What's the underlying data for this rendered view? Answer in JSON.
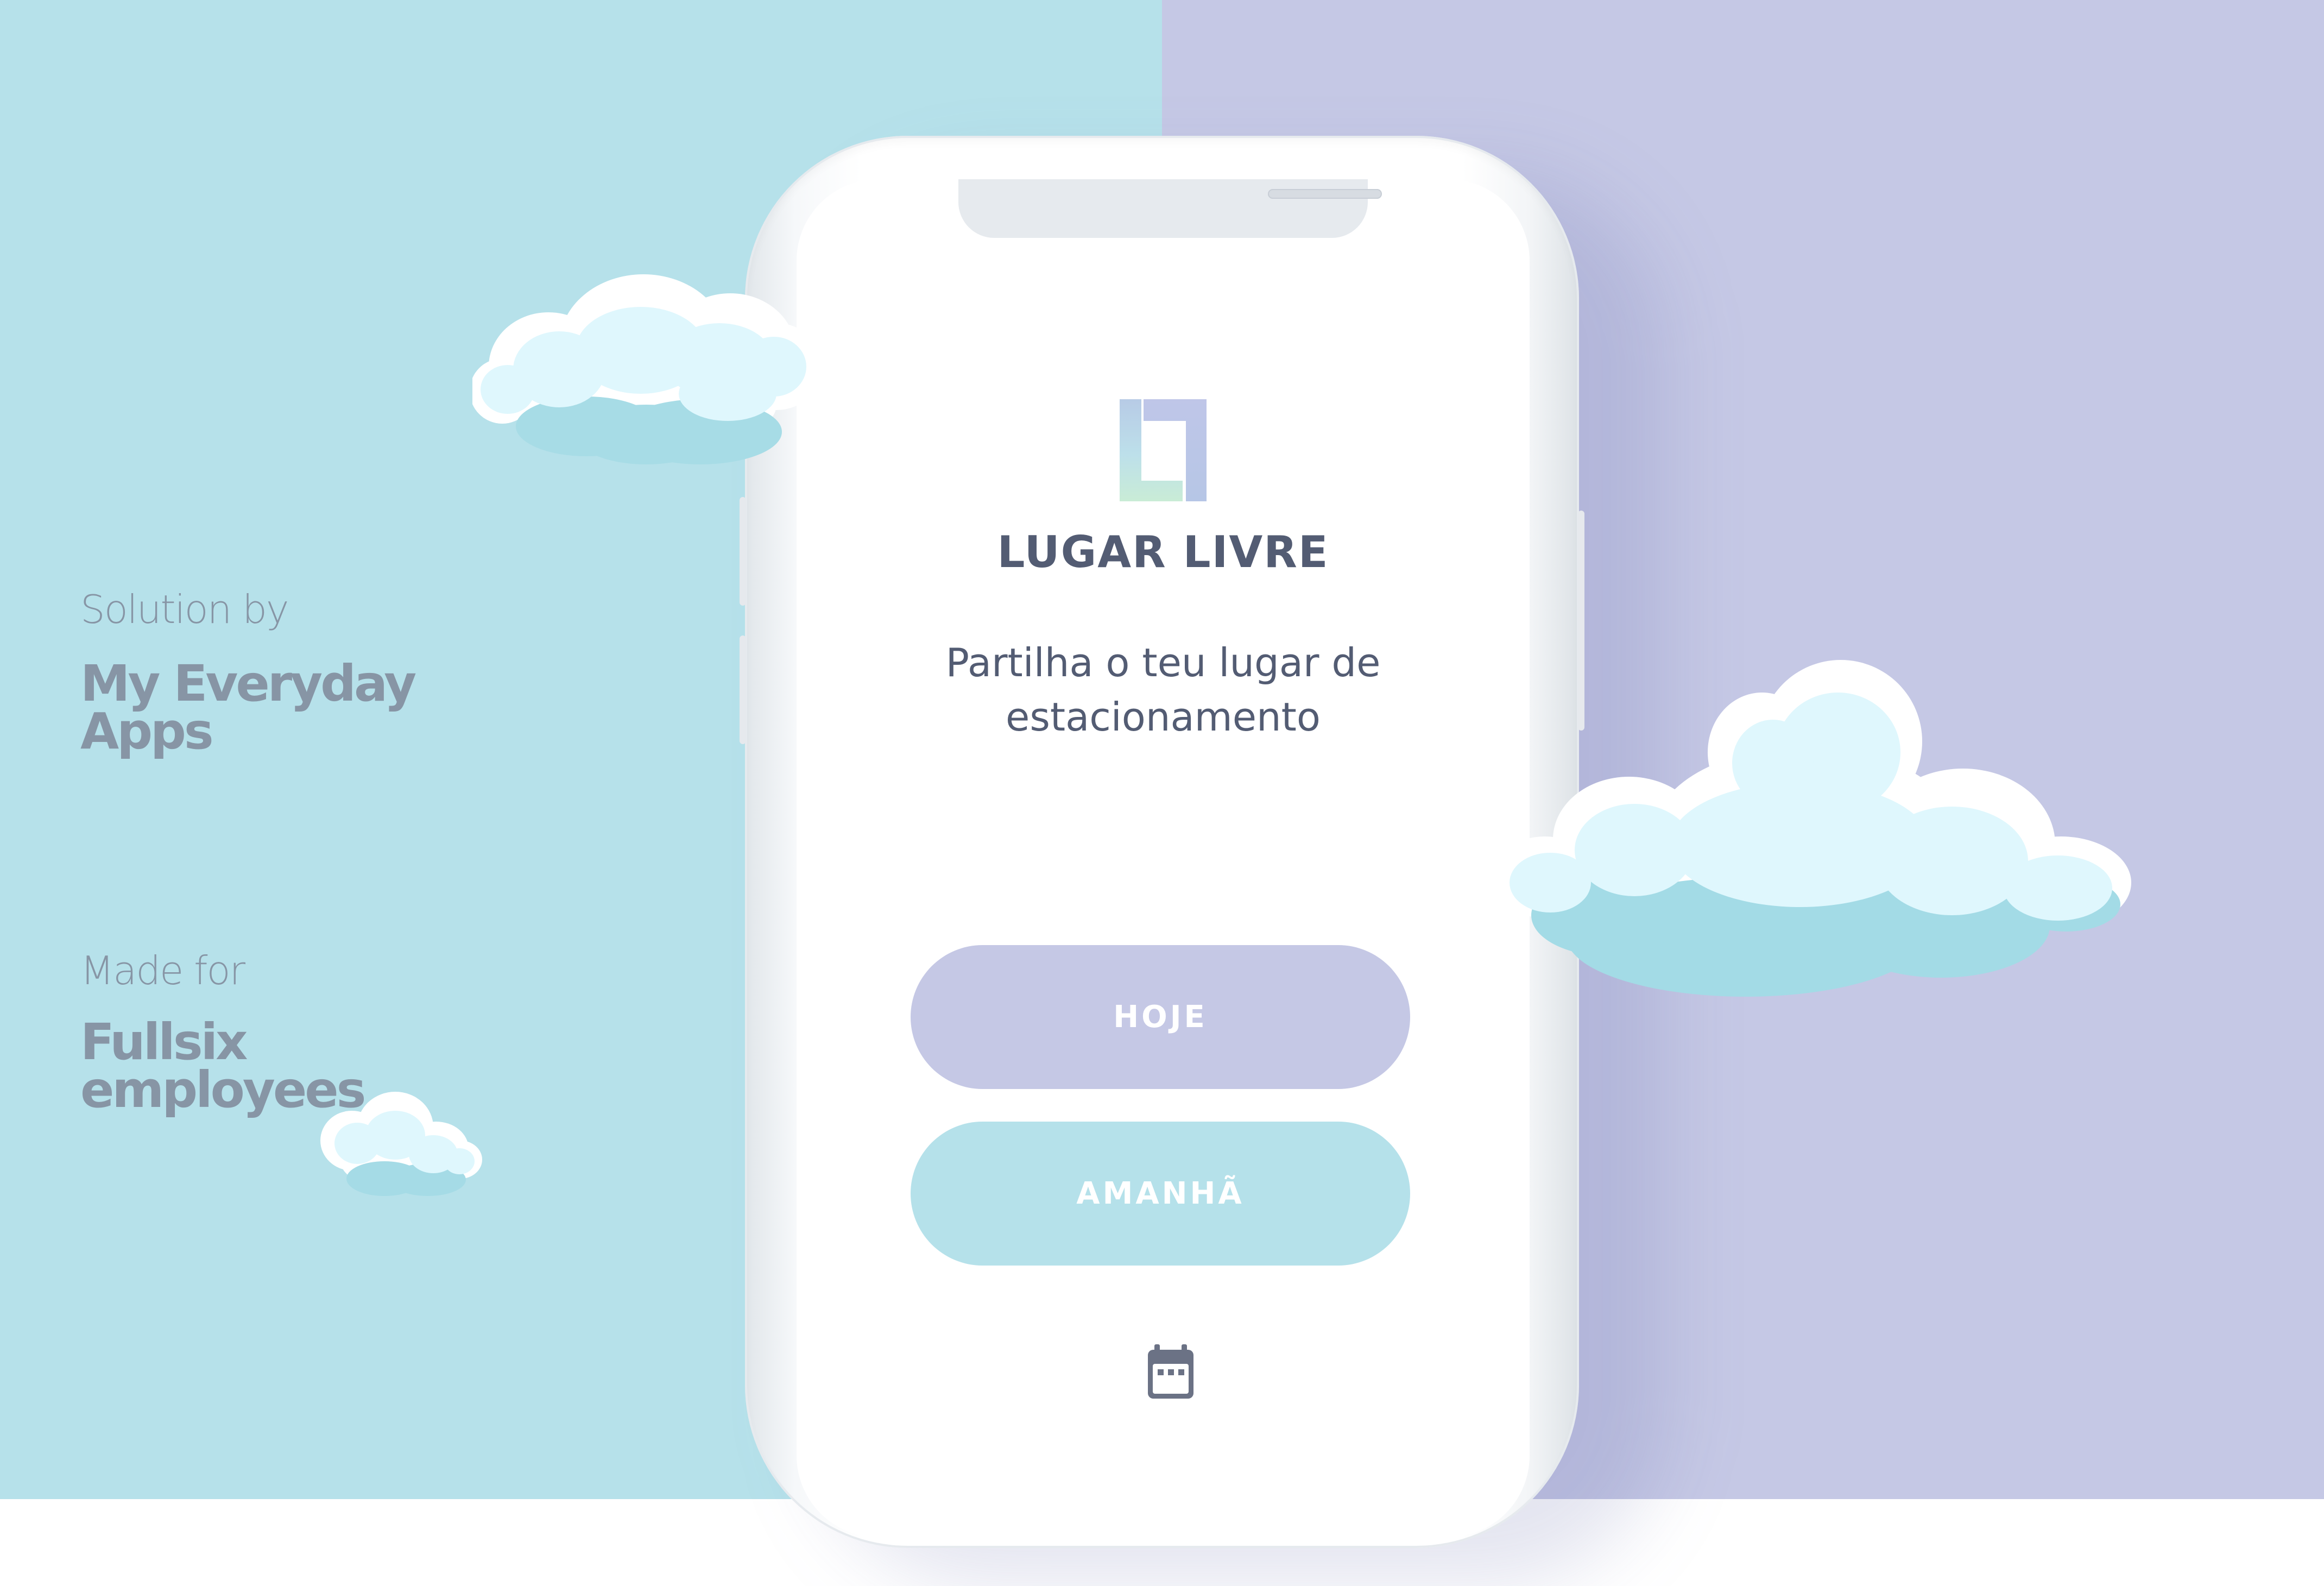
{
  "colors": {
    "background_left": "#b6e1ea",
    "background_right": "#c5c8e5",
    "text_dark": "#535c73",
    "text_side": "#8795a5",
    "button_today": "#c5c8e5",
    "button_tomorrow": "#b5e1ea"
  },
  "side": {
    "solution_caption": "Solution by",
    "solution_name": "My Everyday Apps",
    "made_caption": "Made for",
    "made_name": "Fullsix employees"
  },
  "app": {
    "logo_icon": "lugar-livre-logo",
    "title": "LUGAR LIVRE",
    "subtitle": "Partilha o teu lugar de estacionamento",
    "buttons": {
      "today": "HOJE",
      "tomorrow": "AMANHÃ"
    },
    "calendar_icon": "calendar-icon"
  }
}
